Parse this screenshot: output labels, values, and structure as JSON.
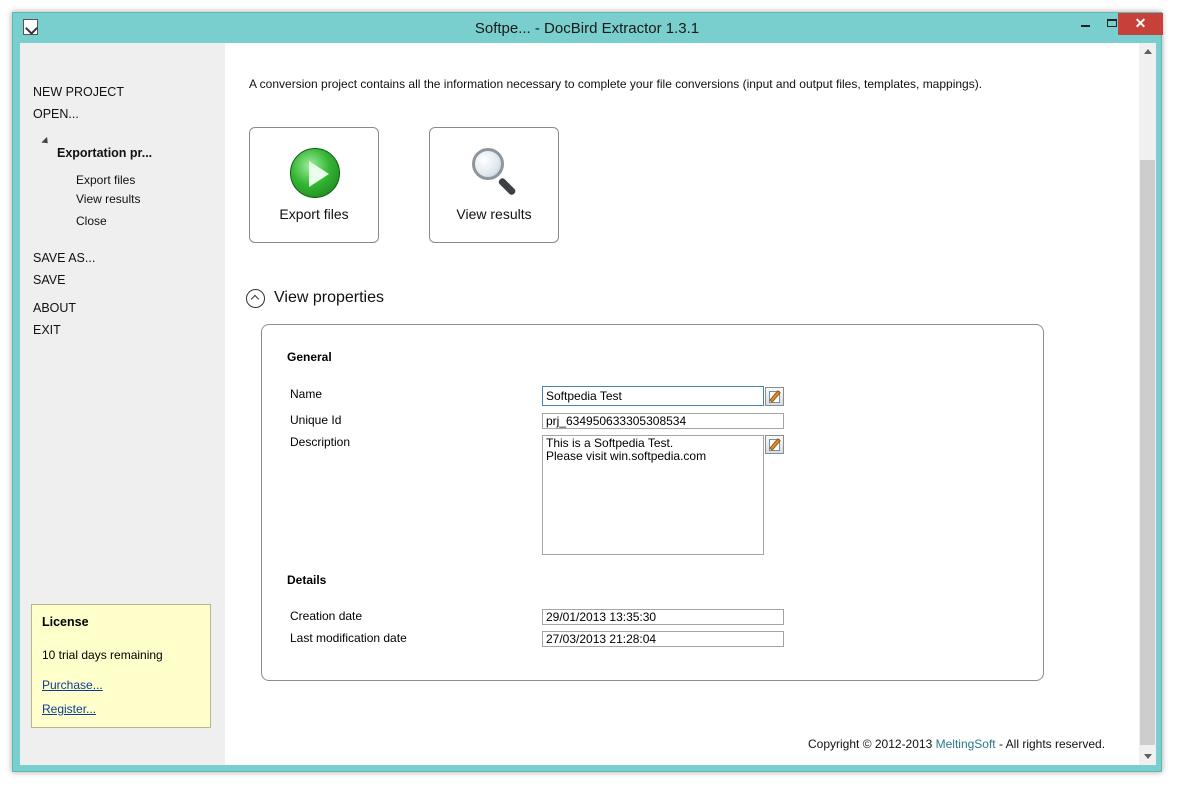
{
  "window": {
    "title": "Softpe... - DocBird Extractor 1.3.1",
    "minimize": "",
    "maximize": "",
    "close": "✕"
  },
  "sidebar": {
    "new_project": "NEW PROJECT",
    "open": "OPEN...",
    "project_name": "Exportation pr...",
    "export_files": "Export files",
    "view_results": "View results",
    "close": "Close",
    "save_as": "SAVE AS...",
    "save": "SAVE",
    "about": "ABOUT",
    "exit": "EXIT"
  },
  "license": {
    "title": "License",
    "days": "10 trial days remaining",
    "purchase": "Purchase...",
    "register": "Register..."
  },
  "main": {
    "intro": "A conversion project contains all the information necessary to complete your file conversions (input and output files, templates, mappings).",
    "export_button": "Export files",
    "view_button": "View results",
    "view_properties": "View properties"
  },
  "properties": {
    "general": "General",
    "name_label": "Name",
    "name_value": "Softpedia Test",
    "uid_label": "Unique Id",
    "uid_value": "prj_634950633305308534",
    "desc_label": "Description",
    "desc_value": "This is a Softpedia Test.\nPlease visit win.softpedia.com",
    "details": "Details",
    "created_label": "Creation date",
    "created_value": "29/01/2013 13:35:30",
    "modified_label": "Last modification date",
    "modified_value": "27/03/2013 21:28:04"
  },
  "footer": {
    "copyright": "Copyright © 2012-2013",
    "company": "MeltingSoft",
    "rights": " - All rights reserved."
  },
  "colors": {
    "titlebar": "#78cfcd",
    "close": "#c7403a",
    "license_bg": "#ffffcc",
    "link": "#2a7a8a"
  }
}
